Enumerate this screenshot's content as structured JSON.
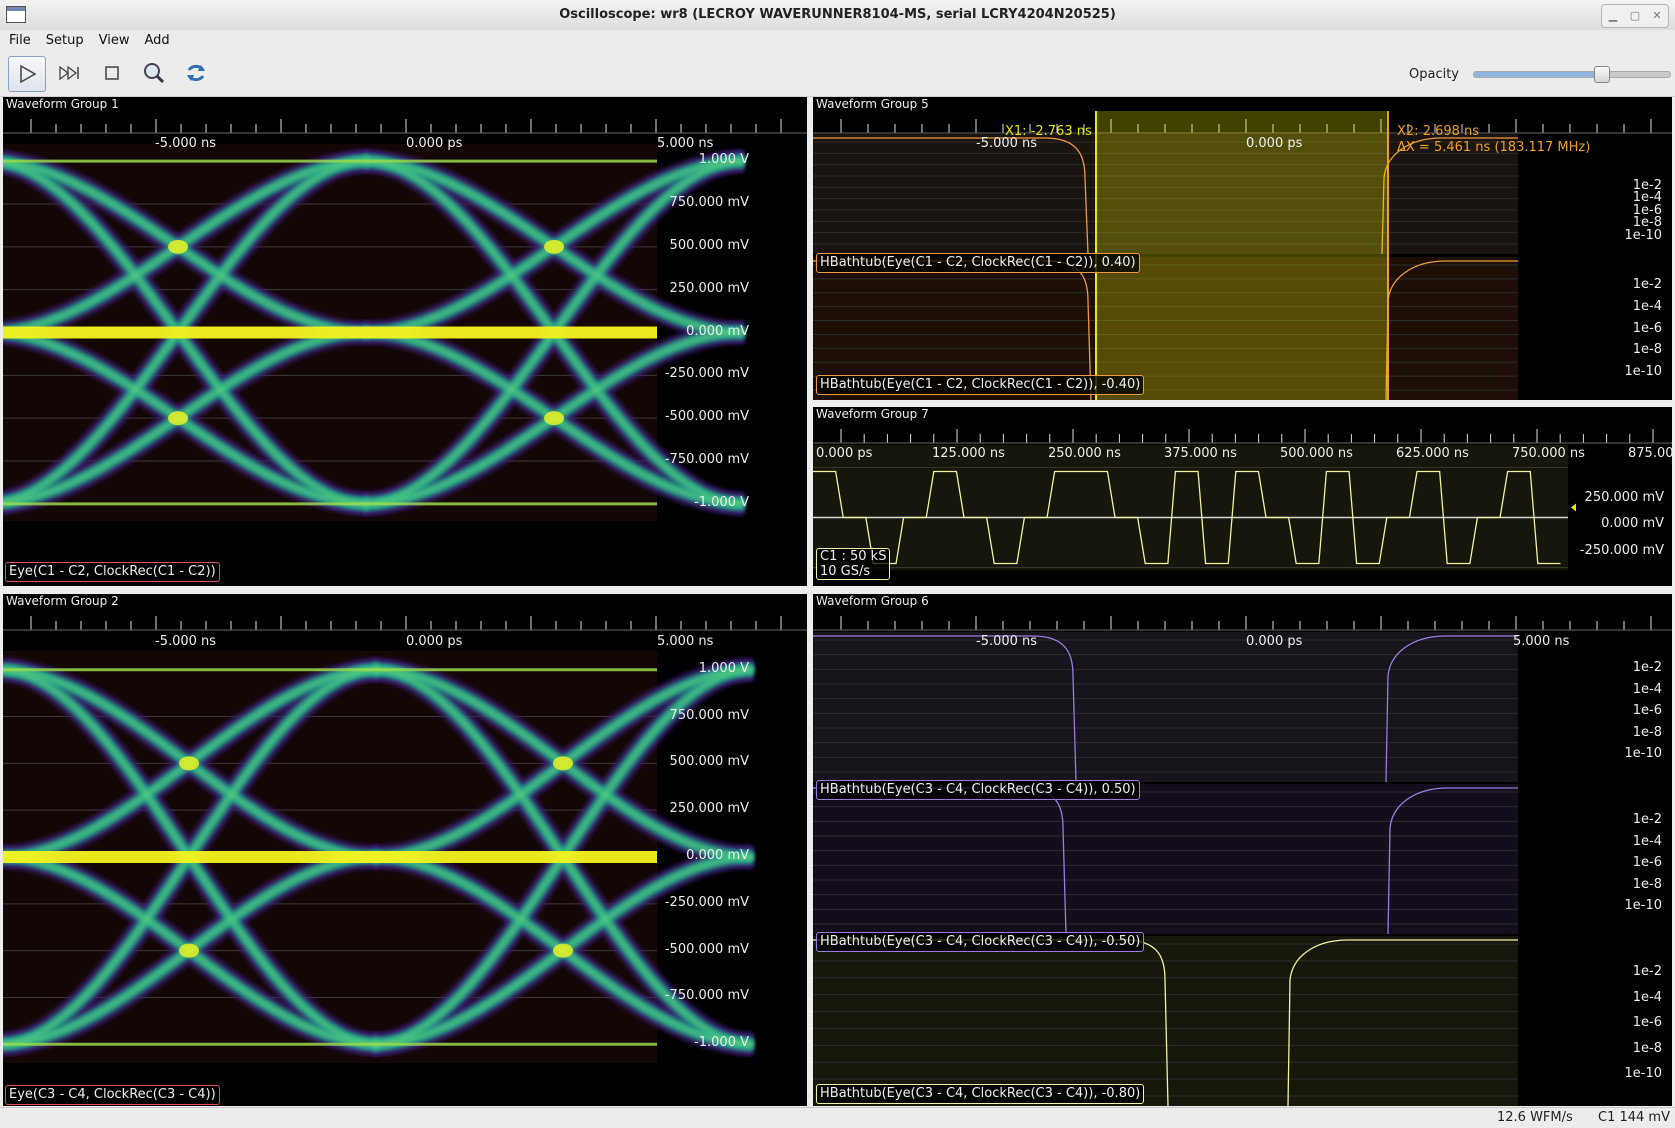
{
  "window": {
    "title": "Oscilloscope: wr8 (LECROY WAVERUNNER8104-MS, serial LCRY4204N20525)"
  },
  "menu": [
    "File",
    "Setup",
    "View",
    "Add"
  ],
  "toolbar": {
    "buttons": [
      "run-icon",
      "single-step-icon",
      "stop-icon",
      "zoom-icon",
      "refresh-icon"
    ],
    "opacity_label": "Opacity",
    "opacity_value": 0.65
  },
  "groups": {
    "g1": {
      "title": "Waveform Group 1",
      "x_ticks": [
        "-5.000 ns",
        "0.000 ps",
        "5.000 ns"
      ],
      "y_ticks": [
        "1.000  V",
        "750.000 mV",
        "500.000 mV",
        "250.000 mV",
        "0.000 mV",
        "-250.000 mV",
        "-500.000 mV",
        "-750.000 mV",
        "-1.000  V"
      ],
      "trace": "Eye(C1 - C2, ClockRec(C1 - C2))"
    },
    "g2": {
      "title": "Waveform Group 2",
      "x_ticks": [
        "-5.000 ns",
        "0.000 ps",
        "5.000 ns"
      ],
      "y_ticks": [
        "1.000  V",
        "750.000 mV",
        "500.000 mV",
        "250.000 mV",
        "0.000 mV",
        "-250.000 mV",
        "-500.000 mV",
        "-750.000 mV",
        "-1.000  V"
      ],
      "trace": "Eye(C3 - C4, ClockRec(C3 - C4))"
    },
    "g5": {
      "title": "Waveform Group 5",
      "x_ticks": [
        "-5.000 ns",
        "0.000 ps"
      ],
      "cursor_x1": "X1: -2.763 ns",
      "cursor_x2": "X2: 2.698 ns",
      "cursor_dx": "ΔX = 5.461 ns (183.117 MHz)",
      "y_ticks": [
        "1e-2",
        "1e-4",
        "1e-6",
        "1e-8",
        "1e-10"
      ],
      "traces": [
        "HBathtub(Eye(C1 - C2, ClockRec(C1 - C2)), 0.40)",
        "HBathtub(Eye(C1 - C2, ClockRec(C1 - C2)), -0.40)"
      ]
    },
    "g7": {
      "title": "Waveform Group 7",
      "x_ticks": [
        "0.000 ps",
        "125.000 ns",
        "250.000 ns",
        "375.000 ns",
        "500.000 ns",
        "625.000 ns",
        "750.000 ns",
        "875.000"
      ],
      "y_ticks": [
        "250.000 mV",
        "0.000 mV",
        "-250.000 mV"
      ],
      "trace_info_1": "C1 : 50 kS",
      "trace_info_2": "10 GS/s"
    },
    "g6": {
      "title": "Waveform Group 6",
      "x_ticks": [
        "-5.000 ns",
        "0.000 ps",
        "5.000 ns"
      ],
      "y_ticks": [
        "1e-2",
        "1e-4",
        "1e-6",
        "1e-8",
        "1e-10"
      ],
      "traces": [
        "HBathtub(Eye(C3 - C4, ClockRec(C3 - C4)), 0.50)",
        "HBathtub(Eye(C3 - C4, ClockRec(C3 - C4)), -0.50)",
        "HBathtub(Eye(C3 - C4, ClockRec(C3 - C4)), -0.80)"
      ]
    }
  },
  "status": {
    "rate": "12.6 WFM/s",
    "cursor": "C1 144 mV"
  },
  "colors": {
    "eye_hot": "#f5f51e",
    "eye_mid": "#24a88a",
    "eye_cold": "#3b1d6e",
    "cursor_x1": "#e8e800",
    "cursor_x2": "#f0a020",
    "trace_orange": "#f09a40",
    "trace_purple": "#9b7be0",
    "trace_yellow": "#f2f2a0"
  }
}
